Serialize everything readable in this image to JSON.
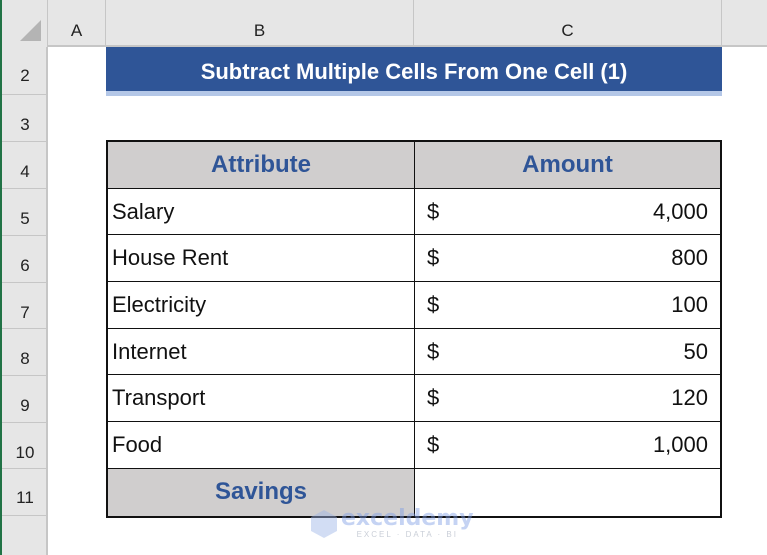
{
  "columns": [
    "A",
    "B",
    "C"
  ],
  "rows": [
    "2",
    "3",
    "4",
    "5",
    "6",
    "7",
    "8",
    "9",
    "10",
    "11"
  ],
  "title": "Subtract Multiple Cells From One Cell (1)",
  "table": {
    "headers": [
      "Attribute",
      "Amount"
    ],
    "items": [
      {
        "attribute": "Salary",
        "currency": "$",
        "amount": "4,000"
      },
      {
        "attribute": "House Rent",
        "currency": "$",
        "amount": "800"
      },
      {
        "attribute": "Electricity",
        "currency": "$",
        "amount": "100"
      },
      {
        "attribute": "Internet",
        "currency": "$",
        "amount": "50"
      },
      {
        "attribute": "Transport",
        "currency": "$",
        "amount": "120"
      },
      {
        "attribute": "Food",
        "currency": "$",
        "amount": "1,000"
      }
    ],
    "footer_label": "Savings",
    "footer_value": ""
  },
  "watermark": {
    "name": "exceldemy",
    "tagline": "EXCEL · DATA · BI"
  },
  "colors": {
    "title_bg": "#2f5597",
    "header_bg": "#d0cece",
    "header_text": "#2f5597",
    "excel_green": "#217346"
  }
}
